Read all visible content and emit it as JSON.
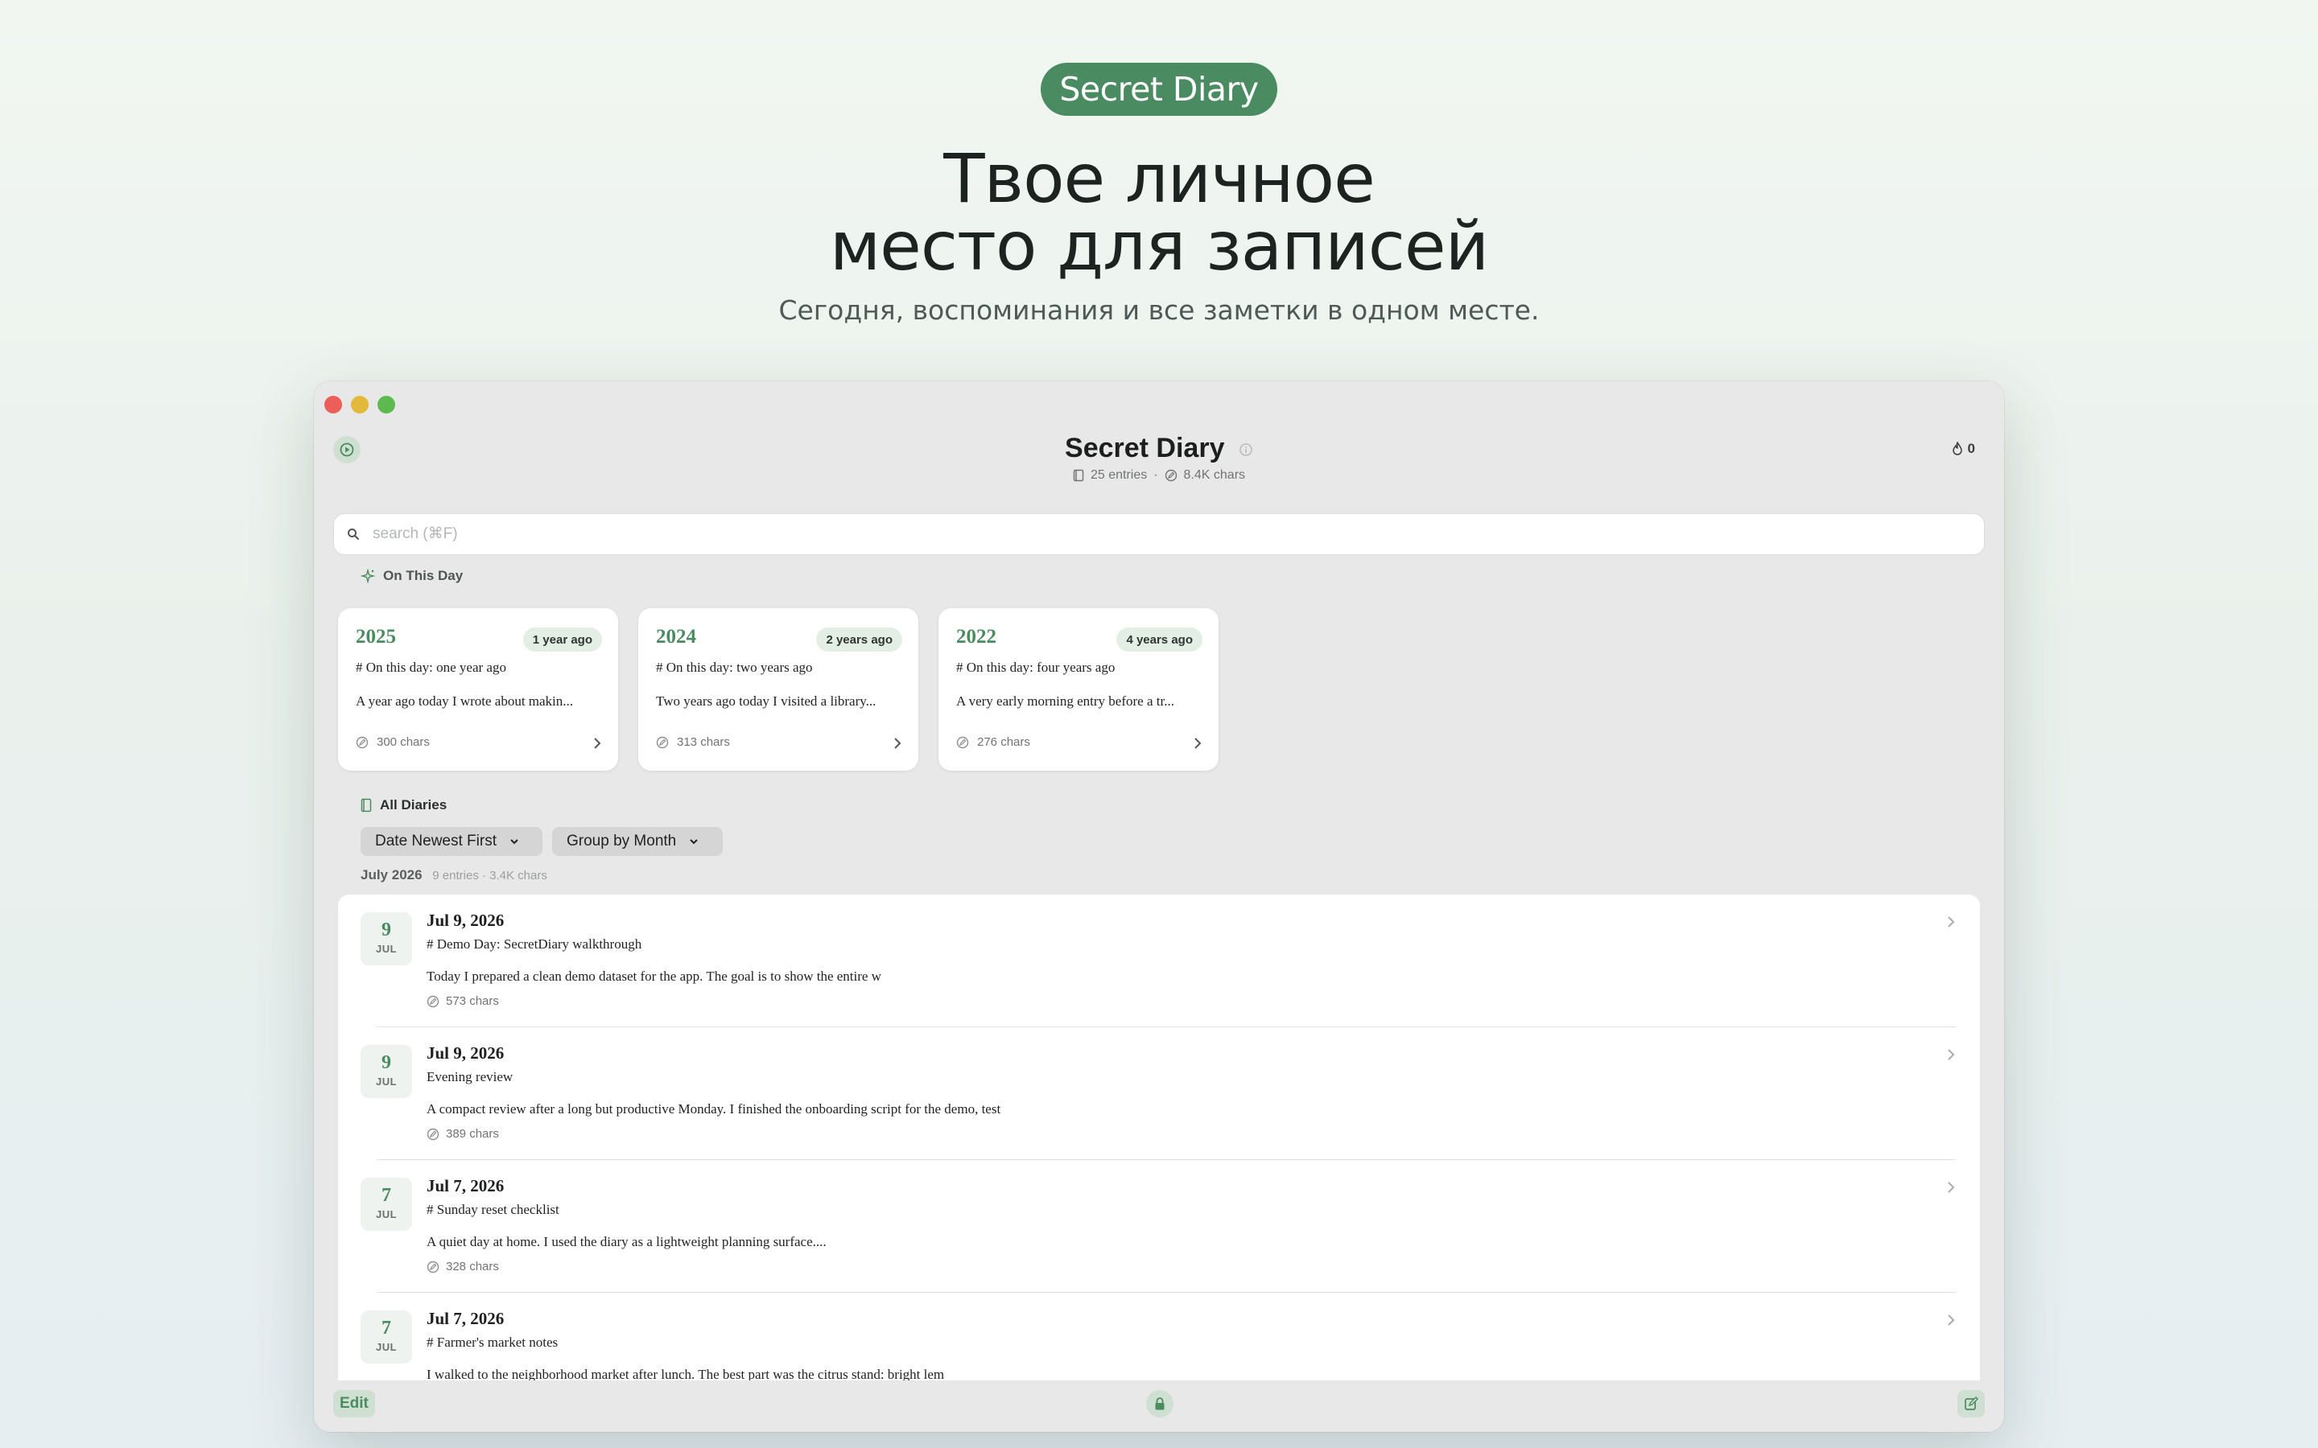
{
  "hero": {
    "badge": "Secret Diary",
    "title_line1": "Твое личное",
    "title_line2": "место для записей",
    "subtitle": "Сегодня, воспоминания и все заметки в одном месте."
  },
  "app": {
    "title": "Secret Diary",
    "entries_count": "25 entries",
    "chars_count": "8.4K chars",
    "streak": "0",
    "search_placeholder": "search (⌘F)"
  },
  "on_this_day": {
    "label": "On This Day",
    "cards": [
      {
        "year": "2025",
        "ago": "1 year ago",
        "title": "# On this day: one year ago",
        "body": "A year ago today I wrote about makin...",
        "chars": "300 chars"
      },
      {
        "year": "2024",
        "ago": "2 years ago",
        "title": "# On this day: two years ago",
        "body": "Two years ago today I visited a library...",
        "chars": "313 chars"
      },
      {
        "year": "2022",
        "ago": "4 years ago",
        "title": "# On this day: four years ago",
        "body": "A very early morning entry before a tr...",
        "chars": "276 chars"
      }
    ]
  },
  "all_diaries": {
    "label": "All Diaries",
    "sort": "Date Newest First",
    "group": "Group by Month",
    "month": "July 2026",
    "month_meta": "9 entries · 3.4K chars",
    "entries": [
      {
        "day": "9",
        "mon": "JUL",
        "date": "Jul 9, 2026",
        "title": "# Demo Day: SecretDiary walkthrough",
        "body": "Today I prepared a clean demo dataset for the app. The goal is to show the entire w",
        "chars": "573 chars"
      },
      {
        "day": "9",
        "mon": "JUL",
        "date": "Jul 9, 2026",
        "title": "Evening review",
        "body": "A compact review after a long but productive Monday. I finished the onboarding script for the demo, test",
        "chars": "389 chars"
      },
      {
        "day": "7",
        "mon": "JUL",
        "date": "Jul 7, 2026",
        "title": "# Sunday reset checklist",
        "body": "A quiet day at home. I used the diary as a lightweight planning surface....",
        "chars": "328 chars"
      },
      {
        "day": "7",
        "mon": "JUL",
        "date": "Jul 7, 2026",
        "title": "# Farmer's market notes",
        "body": "I walked to the neighborhood market after lunch. The best part was the citrus stand: bright lem",
        "chars": ""
      }
    ]
  },
  "bottom": {
    "edit": "Edit"
  },
  "colors": {
    "accent": "#4b8b62",
    "accent_soft": "#cfe0d2",
    "window_bg": "#e8e8e8"
  }
}
